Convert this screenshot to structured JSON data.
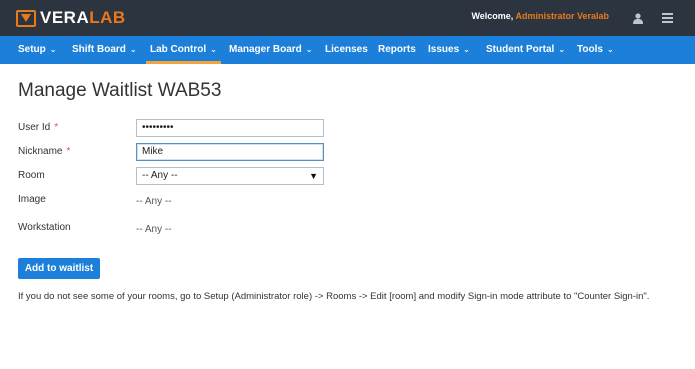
{
  "brand": {
    "name_part1": "VERA",
    "name_part2": "LAB"
  },
  "header": {
    "welcome_prefix": "Welcome, ",
    "user_name": "Administrator Veralab"
  },
  "nav": {
    "items": [
      {
        "label": "Setup",
        "caret": "⌄"
      },
      {
        "label": "Shift Board",
        "caret": "⌄"
      },
      {
        "label": "Lab Control",
        "caret": "⌄"
      },
      {
        "label": "Manager Board",
        "caret": "⌄"
      },
      {
        "label": "Licenses",
        "caret": ""
      },
      {
        "label": "Reports",
        "caret": ""
      },
      {
        "label": "Issues",
        "caret": "⌄"
      },
      {
        "label": "Student Portal",
        "caret": "⌄"
      },
      {
        "label": "Tools",
        "caret": "⌄"
      }
    ],
    "active": "Lab Control"
  },
  "page": {
    "title": "Manage Waitlist WAB53"
  },
  "form": {
    "user_id": {
      "label": "User Id",
      "required_mark": "*",
      "value": "•••••••••"
    },
    "nickname": {
      "label": "Nickname",
      "required_mark": "*",
      "value": "Mike"
    },
    "room": {
      "label": "Room",
      "value": "-- Any --",
      "arrow": "▼"
    },
    "image": {
      "label": "Image",
      "value": "-- Any --"
    },
    "workstation": {
      "label": "Workstation",
      "value": "-- Any --"
    },
    "submit_label": "Add to waitlist"
  },
  "note": "If you do not see some of your rooms, go to Setup (Administrator role) -> Rooms -> Edit [room] and modify Sign-in mode attribute to \"Counter Sign-in\".",
  "colors": {
    "topbar": "#2c3440",
    "navbar": "#1c7fd9",
    "accent": "#e87a1a",
    "required": "#d9534f"
  }
}
